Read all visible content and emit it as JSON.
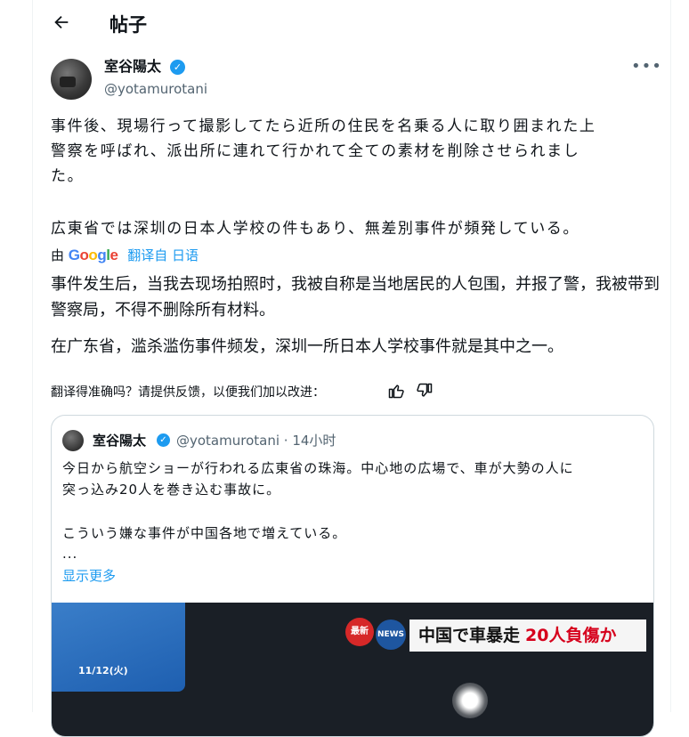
{
  "header": {
    "back_icon": "arrow-left-icon",
    "title": "帖子"
  },
  "author": {
    "name": "室谷陽太",
    "handle": "@yotamurotani",
    "verified_icon": "verified-badge-icon",
    "more_icon": "more-horizontal-icon"
  },
  "post": {
    "paragraph1": "事件後、現場行って撮影してたら近所の住民を名乗る人に取り囲まれた上\n警察を呼ばれ、派出所に連れて行かれて全ての素材を削除させられまし\nた。",
    "paragraph2": "広東省では深圳の日本人学校の件もあり、無差別事件が頻発している。"
  },
  "translation": {
    "by_label": "由",
    "google_logo": "Google",
    "translated_from": "翻译自 日语",
    "paragraph1": "事件发生后，当我去现场拍照时，我被自称是当地居民的人包围，并报了警，我被带到警察局，不得不删除所有材料。",
    "paragraph2": "在广东省，滥杀滥伤事件频发，深圳一所日本人学校事件就是其中之一。",
    "feedback_prompt": "翻译得准确吗？请提供反馈，以便我们加以改进：",
    "thumbs_up_icon": "thumbs-up-icon",
    "thumbs_down_icon": "thumbs-down-icon"
  },
  "quote": {
    "name": "室谷陽太",
    "handle_time": "@yotamurotani · 14小时",
    "line1": "今日から航空ショーが行われる広東省の珠海。中心地の広場で、車が大勢の人に\n突っ込み20人を巻き込む事故に。",
    "line2": "こういう嫌な事件が中国各地で増えている。",
    "ellipsis": "...",
    "show_more": "显示更多",
    "media": {
      "date_strip": "11/12(火)",
      "badge": "最新",
      "news_label": "NEWS",
      "headline_main": "中国で車暴走",
      "headline_red": "20人負傷か"
    }
  },
  "colors": {
    "accent": "#1d9bf0",
    "text": "#0f1419",
    "secondary": "#536471",
    "border": "#cfd9de",
    "headline_red": "#d6001c"
  }
}
